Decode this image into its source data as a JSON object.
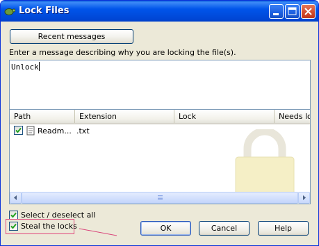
{
  "window": {
    "title": "Lock Files",
    "controls": [
      "minimize-icon",
      "maximize-icon",
      "close-icon"
    ]
  },
  "recent_button": "Recent messages",
  "message_prompt": "Enter a message describing why you are locking the file(s).",
  "message_value": "Unlock",
  "table": {
    "columns": [
      "Path",
      "Extension",
      "Lock",
      "Needs loc"
    ],
    "rows": [
      {
        "checked": true,
        "icon": "document-icon",
        "path": "Readm...",
        "extension": ".txt",
        "lock": "",
        "needs_lock": ""
      }
    ]
  },
  "select_all": {
    "label": "Select / deselect all",
    "checked": true
  },
  "steal_locks": {
    "label": "Steal the locks",
    "checked": true
  },
  "buttons": {
    "ok": "OK",
    "cancel": "Cancel",
    "help": "Help"
  },
  "colors": {
    "title_bar": "#0055ea",
    "dialog_bg": "#ece9d8",
    "highlight_box": "#e0457a",
    "checkbox_tick": "#21a121"
  }
}
